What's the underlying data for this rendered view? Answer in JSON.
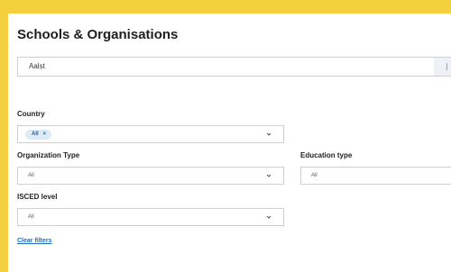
{
  "page": {
    "title": "Schools & Organisations"
  },
  "search": {
    "value": "Aalst"
  },
  "filters": {
    "country": {
      "label": "Country",
      "chip": "All",
      "chip_remove": "×"
    },
    "organization_type": {
      "label": "Organization Type",
      "value": "All"
    },
    "education_type": {
      "label": "Education type",
      "value": "All"
    },
    "isced_level": {
      "label": "ISCED level",
      "value": "All"
    }
  },
  "actions": {
    "clear_filters": "Clear filters"
  },
  "colors": {
    "background": "#f4d03f",
    "accent": "#1f6dc1",
    "chip_bg": "#dfeaf7"
  },
  "icons": {
    "dropdown": "chevron-down-icon",
    "chip_remove": "close-icon"
  }
}
